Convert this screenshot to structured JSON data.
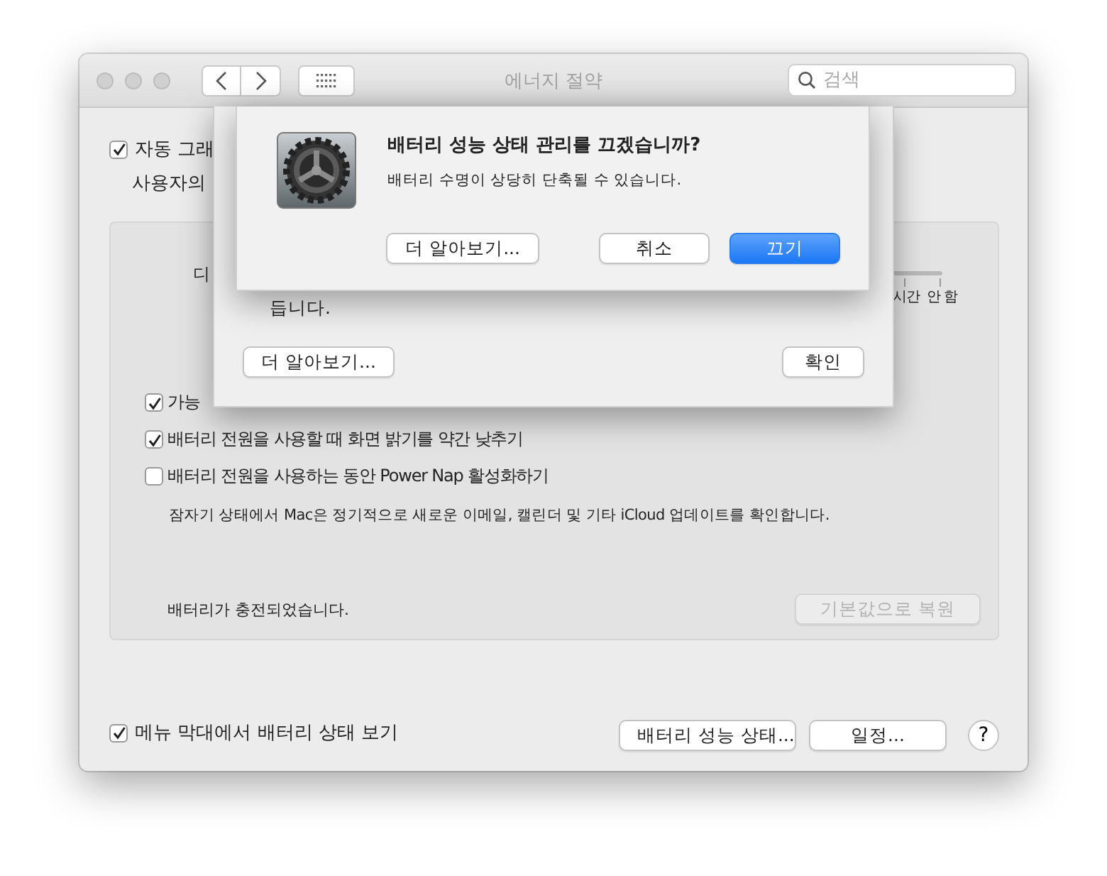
{
  "window": {
    "title": "에너지 절약",
    "search": {
      "placeholder": "검색"
    }
  },
  "top_option": {
    "label": "자동 그래",
    "checked": true,
    "description": "사용자의"
  },
  "panel": {
    "display_sleep_label": "디",
    "slider_labels": [
      "시간",
      "안 함"
    ],
    "options": [
      {
        "label": "가능",
        "checked": true
      },
      {
        "label": "배터리 전원을 사용할 때 화면 밝기를 약간 낮추기",
        "checked": true
      },
      {
        "label": "배터리 전원을 사용하는 동안 Power Nap 활성화하기",
        "checked": false,
        "description": "잠자기 상태에서 Mac은 정기적으로 새로운 이메일, 캘린더 및 기타 iCloud 업데이트를 확인합니다."
      }
    ],
    "status": "배터리가 충전되었습니다.",
    "restore_button": {
      "label": "기본값으로 복원",
      "disabled": true
    }
  },
  "bottom": {
    "menu_bar_option": {
      "label": "메뉴 막대에서 배터리 상태 보기",
      "checked": true
    },
    "buttons": [
      "배터리 성능 상태...",
      "일정..."
    ],
    "help": "?"
  },
  "battery_health_sheet": {
    "text": "듭니다.",
    "buttons": [
      {
        "label": "더 알아보기...",
        "kind": "normal"
      },
      {
        "label": "확인",
        "kind": "normal"
      }
    ]
  },
  "alert": {
    "title": "배터리 성능 상태 관리를 끄겠습니까?",
    "message": "배터리 수명이 상당히 단축될 수 있습니다.",
    "buttons": [
      {
        "label": "더 알아보기...",
        "kind": "normal"
      },
      {
        "label": "취소",
        "kind": "normal"
      },
      {
        "label": "끄기",
        "kind": "default"
      }
    ]
  }
}
